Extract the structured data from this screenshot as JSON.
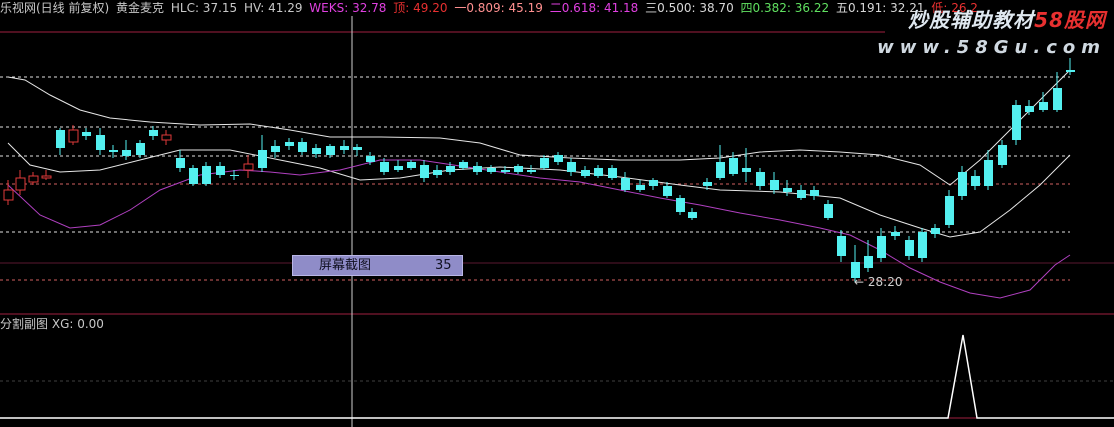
{
  "header": {
    "app_name": "乐视网(日线 前复权)",
    "indicator_name": "黄金麦克",
    "hlc": "HLC: 37.15",
    "hv": "HV: 41.29",
    "weks": "WEKS: 32.78",
    "ding": "顶: 49.20",
    "level1": "一0.809: 45.19",
    "level2": "二0.618: 41.18",
    "level3": "三0.500: 38.70",
    "level4": "四0.382: 36.22",
    "level5": "五0.191: 32.21",
    "di": "低: 26.2"
  },
  "watermark": {
    "title_part1": "炒股辅助教材",
    "title_part2": "58股网",
    "url": "www.58Gu.com"
  },
  "subchart": {
    "label": "分割副图",
    "xg": "XG: 0.00"
  },
  "screenshot_box": {
    "label": "屏幕截图",
    "value": "35"
  },
  "min_marker": "28:20",
  "colors": {
    "background": "#000000",
    "header_default": "#c8c8c8",
    "weks": "#e040e0",
    "ding": "#e83030",
    "level1": "#ff9090",
    "level2": "#e040e0",
    "level3": "#d8d8d8",
    "level4": "#60e060",
    "level5": "#d8d8d8",
    "di": "#e83030",
    "up_candle": "#e03a3a",
    "down_candle": "#54f0f0",
    "upper_band": "#e6e6e6",
    "lower_band": "#b040c0",
    "level_line": "#d8d8d8",
    "panel_divider": "#a02040",
    "signal_line": "#ffffff"
  }
}
